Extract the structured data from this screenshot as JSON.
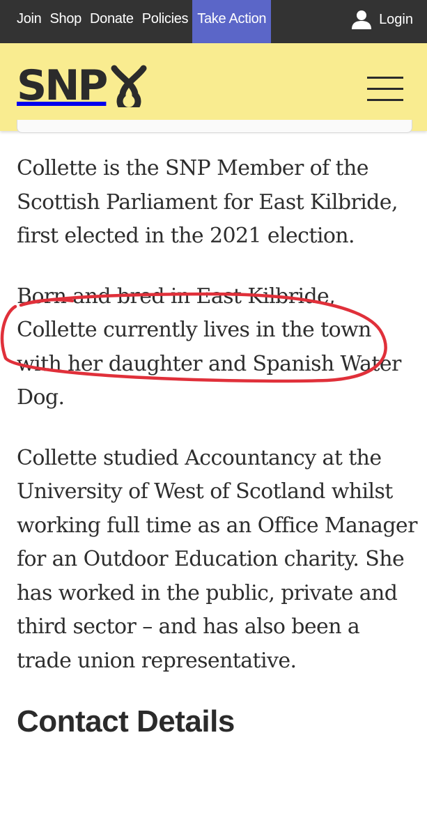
{
  "topnav": {
    "items": [
      {
        "label": "Join"
      },
      {
        "label": "Shop"
      },
      {
        "label": "Donate"
      },
      {
        "label": "Policies"
      },
      {
        "label": "Take Action"
      }
    ],
    "login_label": "Login",
    "login_icon": "user-icon"
  },
  "header": {
    "logo_text": "SNP",
    "logo_icon": "snp-loop-logo",
    "menu_icon": "hamburger-icon"
  },
  "colors": {
    "topbar_bg": "#333333",
    "take_action_bg": "#5b66c8",
    "brand_yellow": "#f9ec90",
    "annotation_red": "#e0303a"
  },
  "main": {
    "paragraphs": [
      "Collette is the SNP Member of the Scottish Parliament for East Kilbride, first elected in the 2021 election.",
      "Born and bred in East Kilbride, Collette currently lives in the town with her daughter and Spanish Water Dog.",
      "Collette studied Accountancy at the University of West of Scotland whilst working full time as an Office Manager for an Outdoor Education charity. She has worked in the public, private and third sector – and has also been a trade union representative."
    ],
    "section_heading": "Contact Details"
  }
}
